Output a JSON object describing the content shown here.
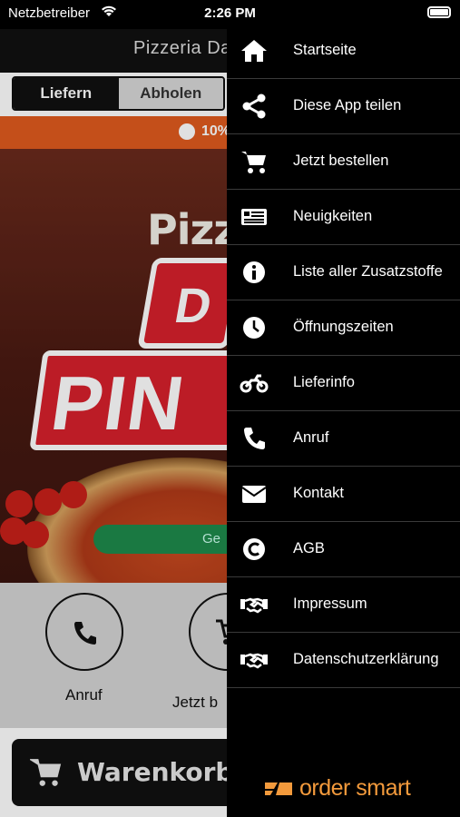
{
  "status_bar": {
    "carrier": "Netzbetreiber",
    "time": "2:26 PM"
  },
  "navbar": {
    "title": "Pizzeria Da"
  },
  "order_mode": {
    "delivery": "Liefern",
    "pickup": "Abholen",
    "selected": "Liefern"
  },
  "promo": {
    "text": "10%"
  },
  "hero": {
    "logo_line1": "Pizz",
    "logo_letter": "D",
    "logo_line3": "PIN",
    "order_button": "Ge"
  },
  "actions": {
    "call_label": "Anruf",
    "order_label": "Jetzt b"
  },
  "cart": {
    "label": "Warenkorb"
  },
  "drawer": {
    "items": [
      {
        "label": "Startseite",
        "icon": "home-icon"
      },
      {
        "label": "Diese App teilen",
        "icon": "share-icon"
      },
      {
        "label": "Jetzt bestellen",
        "icon": "cart-icon"
      },
      {
        "label": "Neuigkeiten",
        "icon": "news-icon"
      },
      {
        "label": "Liste aller Zusatzstoffe",
        "icon": "info-icon"
      },
      {
        "label": "Öffnungszeiten",
        "icon": "clock-icon"
      },
      {
        "label": "Lieferinfo",
        "icon": "motorcycle-icon"
      },
      {
        "label": "Anruf",
        "icon": "phone-icon"
      },
      {
        "label": "Kontakt",
        "icon": "envelope-icon"
      },
      {
        "label": "AGB",
        "icon": "copyright-icon"
      },
      {
        "label": "Impressum",
        "icon": "handshake-icon"
      },
      {
        "label": "Datenschutzerklärung",
        "icon": "handshake-icon"
      }
    ],
    "brand": "order smart"
  },
  "colors": {
    "drawer_bg": "#000000",
    "promo": "#e05a1e",
    "accent_green": "#1e8a4c",
    "brand_orange": "#f39a3c",
    "logo_red": "#d6202c"
  }
}
